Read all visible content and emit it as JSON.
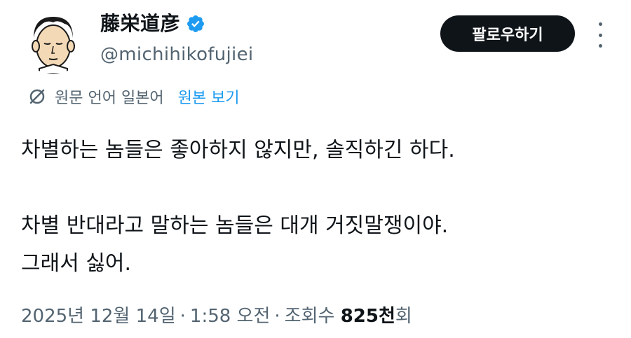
{
  "author": {
    "display_name": "藤栄道彦",
    "handle": "@michihikofujiei",
    "verified": true
  },
  "actions": {
    "follow_label": "팔로우하기"
  },
  "translation": {
    "original_language": "원문 언어 일본어",
    "view_original_label": "원본 보기"
  },
  "tweet": {
    "lines": [
      "차별하는 놈들은 좋아하지 않지만, 솔직하긴 하다.",
      "",
      "차별 반대라고 말하는 놈들은 대개 거짓말쟁이야.",
      "그래서 싫어."
    ]
  },
  "meta": {
    "date": "2025년 12월 14일",
    "separator": "·",
    "time": "1:58 오전",
    "views_prefix": "조회수",
    "views_count": "825천",
    "views_suffix": "회"
  },
  "colors": {
    "text_primary": "#0f1419",
    "text_secondary": "#536471",
    "link": "#1d9bf0",
    "verified": "#1d9bf0",
    "button_bg": "#0f1419"
  }
}
